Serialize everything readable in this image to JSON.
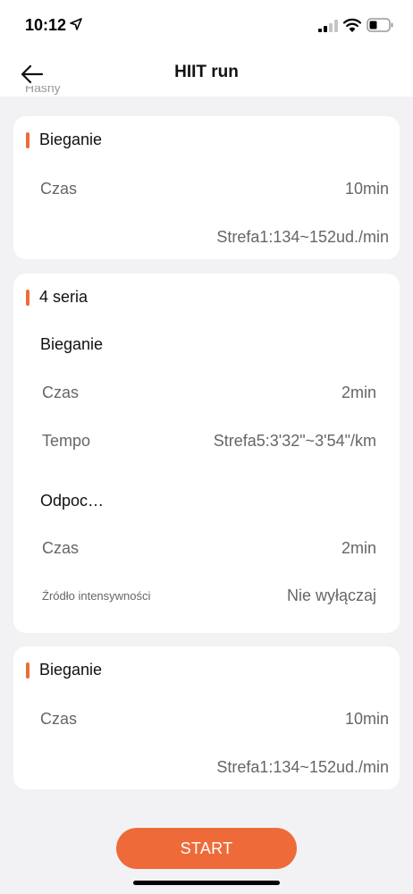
{
  "status_bar": {
    "time": "10:12",
    "icons": [
      "location-arrow-icon",
      "cellular-signal-icon",
      "wifi-icon",
      "battery-icon"
    ]
  },
  "nav": {
    "title": "HIIT run",
    "back_icon": "back-arrow-icon"
  },
  "clipped_label": "Hasny",
  "colors": {
    "accent": "#ee6b39",
    "background": "#f2f2f4",
    "card": "#ffffff"
  },
  "cards": [
    {
      "title": "Bieganie",
      "rows": [
        {
          "label": "Czas",
          "value": "10min"
        }
      ],
      "zone": "Strefa1:134~152ud./min"
    },
    {
      "title": "4 seria",
      "sections": [
        {
          "title": "Bieganie",
          "rows": [
            {
              "label": "Czas",
              "value": "2min"
            },
            {
              "label": "Tempo",
              "value": "Strefa5:3'32\"~3'54\"/km"
            }
          ]
        },
        {
          "title": "Odpoc…",
          "rows": [
            {
              "label": "Czas",
              "value": "2min"
            },
            {
              "label": "Źródło intensywności",
              "value": "Nie wyłączaj"
            }
          ]
        }
      ]
    },
    {
      "title": "Bieganie",
      "rows": [
        {
          "label": "Czas",
          "value": "10min"
        }
      ],
      "zone": "Strefa1:134~152ud./min"
    }
  ],
  "start_button": "START"
}
